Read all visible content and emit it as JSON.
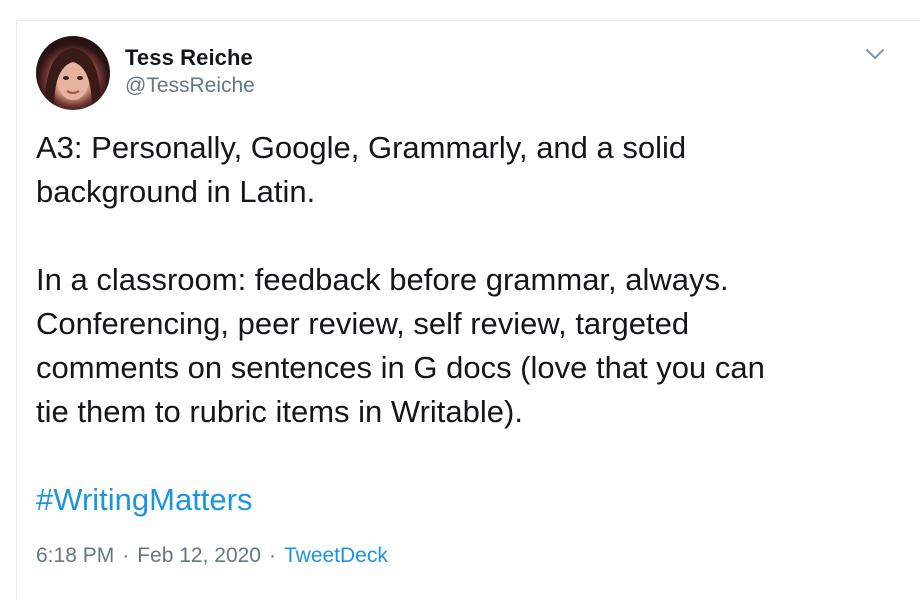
{
  "tweet": {
    "author": {
      "name": "Tess Reiche",
      "handle": "@TessReiche"
    },
    "text": {
      "paragraph1_line1": "A3: Personally, Google, Grammarly, and a solid",
      "paragraph1_line2": "background in Latin.",
      "paragraph2_line1": "In a classroom: feedback before grammar, always.",
      "paragraph2_line2": "Conferencing, peer review, self review, targeted",
      "paragraph2_line3": "comments on sentences in G docs (love that you can",
      "paragraph2_line4": "tie them to rubric items in Writable).",
      "hashtag": "#WritingMatters"
    },
    "meta": {
      "time": "6:18 PM",
      "separator": "·",
      "date": "Feb 12, 2020",
      "source": "TweetDeck"
    }
  },
  "icons": {
    "more_menu": "chevron-down-icon"
  },
  "colors": {
    "link": "#1b95e0",
    "secondary_text": "#657786",
    "primary_text": "#14171a"
  }
}
